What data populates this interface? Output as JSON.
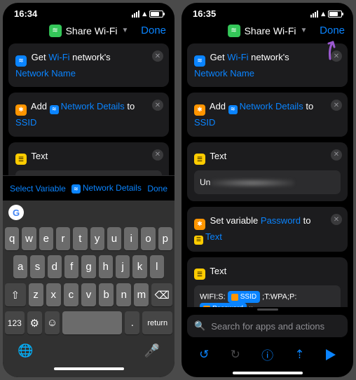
{
  "status": {
    "time": "16:34",
    "time2": "16:35"
  },
  "nav": {
    "title": "Share Wi-Fi",
    "done": "Done"
  },
  "cards": {
    "get": {
      "a": "Get",
      "b": "Wi-Fi",
      "c": "network's",
      "d": "Network Name"
    },
    "add": {
      "a": "Add",
      "b": "Network Details",
      "c": "to",
      "d": "SSID"
    },
    "text": {
      "label": "Text",
      "value": "Un"
    },
    "setvar": {
      "a": "Set variable",
      "b": "Password",
      "c": "to",
      "d": "Text"
    },
    "wifistr": {
      "label": "Text",
      "pre": "WIFI:S:",
      "tok1": "SSID",
      "mid": ";T:WPA;P:",
      "tok2": "Password",
      "end": ";;"
    }
  },
  "varbar": {
    "select": "Select Variable",
    "netdet": "Network Details",
    "done": "Done"
  },
  "keyboard": {
    "r1": [
      "q",
      "w",
      "e",
      "r",
      "t",
      "y",
      "u",
      "i",
      "o",
      "p"
    ],
    "r2": [
      "a",
      "s",
      "d",
      "f",
      "g",
      "h",
      "j",
      "k",
      "l"
    ],
    "r3": [
      "z",
      "x",
      "c",
      "v",
      "b",
      "n",
      "m"
    ],
    "num": "123",
    "space": "space",
    "ret": "return"
  },
  "search": {
    "placeholder": "Search for apps and actions"
  }
}
